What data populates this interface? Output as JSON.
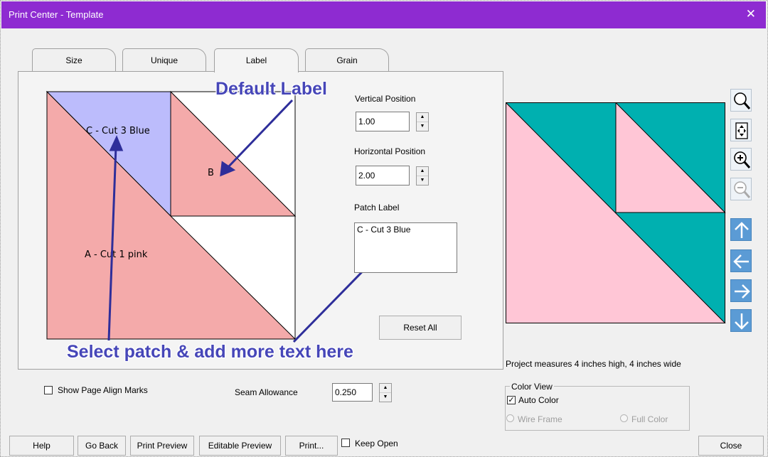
{
  "window": {
    "title": "Print Center - Template",
    "close_glyph": "✕"
  },
  "tabs": [
    {
      "label": "Size"
    },
    {
      "label": "Unique"
    },
    {
      "label": "Label",
      "active": true
    },
    {
      "label": "Grain"
    }
  ],
  "template": {
    "patch_labels": {
      "a": "A - Cut 1  pink",
      "b": "B",
      "c": "C - Cut 3 Blue"
    },
    "colors": {
      "pink": "#f4aaaa",
      "blue": "#bcbcfc"
    }
  },
  "label_panel": {
    "vertical_position_label": "Vertical Position",
    "vertical_position_value": "1.00",
    "horizontal_position_label": "Horizontal Position",
    "horizontal_position_value": "2.00",
    "patch_label_label": "Patch Label",
    "patch_label_value": "C - Cut 3 Blue",
    "reset_all": "Reset All"
  },
  "annotations": {
    "default_label": "Default Label",
    "select_patch": "Select patch & add more text here"
  },
  "preview": {
    "colors": {
      "teal": "#00b0b0",
      "pink": "#ffc6d6"
    },
    "measure_text": "Project measures 4 inches high, 4 inches wide"
  },
  "toolbar_icons": [
    "zoom-icon",
    "fit-page-icon",
    "zoom-in-icon",
    "zoom-out-icon",
    "arrow-up-icon",
    "arrow-left-icon",
    "arrow-right-icon",
    "arrow-down-icon"
  ],
  "options": {
    "show_page_align_marks": "Show Page Align Marks",
    "seam_allowance_label": "Seam Allowance",
    "seam_allowance_value": "0.250"
  },
  "color_view": {
    "title": "Color View",
    "auto_color": "Auto Color",
    "auto_color_checked": true,
    "wire_frame": "Wire Frame",
    "full_color": "Full Color"
  },
  "buttons": {
    "help": "Help",
    "go_back": "Go Back",
    "print_preview": "Print Preview",
    "editable_preview": "Editable Preview",
    "print": "Print...",
    "keep_open": "Keep Open",
    "close": "Close"
  }
}
